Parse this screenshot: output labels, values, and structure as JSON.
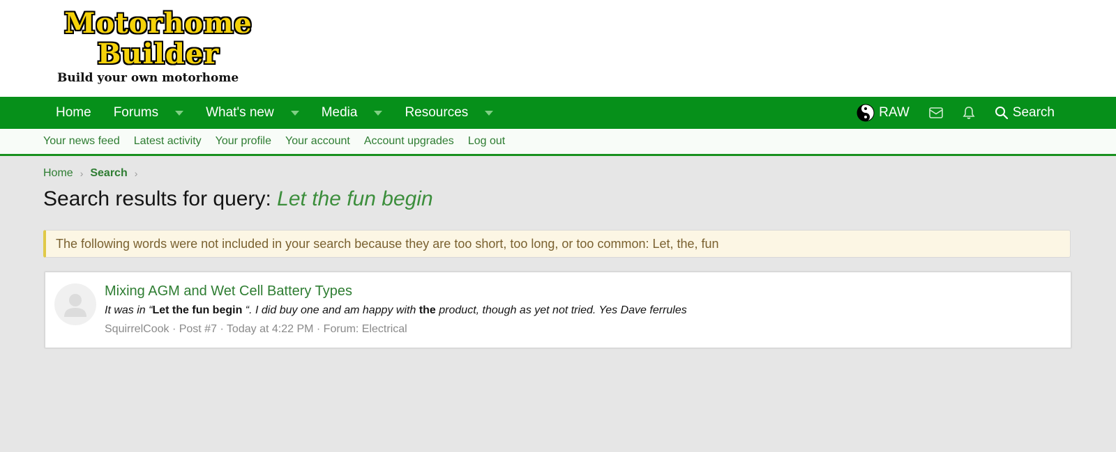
{
  "logo": {
    "line1": "Motorhome",
    "line2": "Builder",
    "tagline": "Build your own motorhome"
  },
  "nav": {
    "items": [
      {
        "label": "Home",
        "has_menu": false
      },
      {
        "label": "Forums",
        "has_menu": true
      },
      {
        "label": "What's new",
        "has_menu": true
      },
      {
        "label": "Media",
        "has_menu": true
      },
      {
        "label": "Resources",
        "has_menu": true
      }
    ],
    "user": "RAW",
    "search_label": "Search"
  },
  "subnav": {
    "items": [
      "Your news feed",
      "Latest activity",
      "Your profile",
      "Your account",
      "Account upgrades",
      "Log out"
    ]
  },
  "breadcrumb": {
    "home": "Home",
    "search": "Search"
  },
  "page": {
    "title_prefix": "Search results for query:",
    "query": "Let the fun begin"
  },
  "notice": {
    "text": "The following words were not included in your search because they are too short, too long, or too common: Let, the, fun"
  },
  "result": {
    "title": "Mixing AGM and Wet Cell Battery Types",
    "snippet_pre": "It was in “",
    "snippet_bold1": "Let the fun begin",
    "snippet_mid": " “. I did buy one and am happy with ",
    "snippet_bold2": "the",
    "snippet_post": " product, though as yet not tried. Yes Dave ferrules",
    "author": "SquirrelCook",
    "post": "Post #7",
    "time": "Today at 4:22 PM",
    "forum": "Forum: Electrical"
  },
  "colors": {
    "nav_bg": "#06901a",
    "link": "#2e7d32",
    "notice_bg": "#fcf6e4"
  }
}
